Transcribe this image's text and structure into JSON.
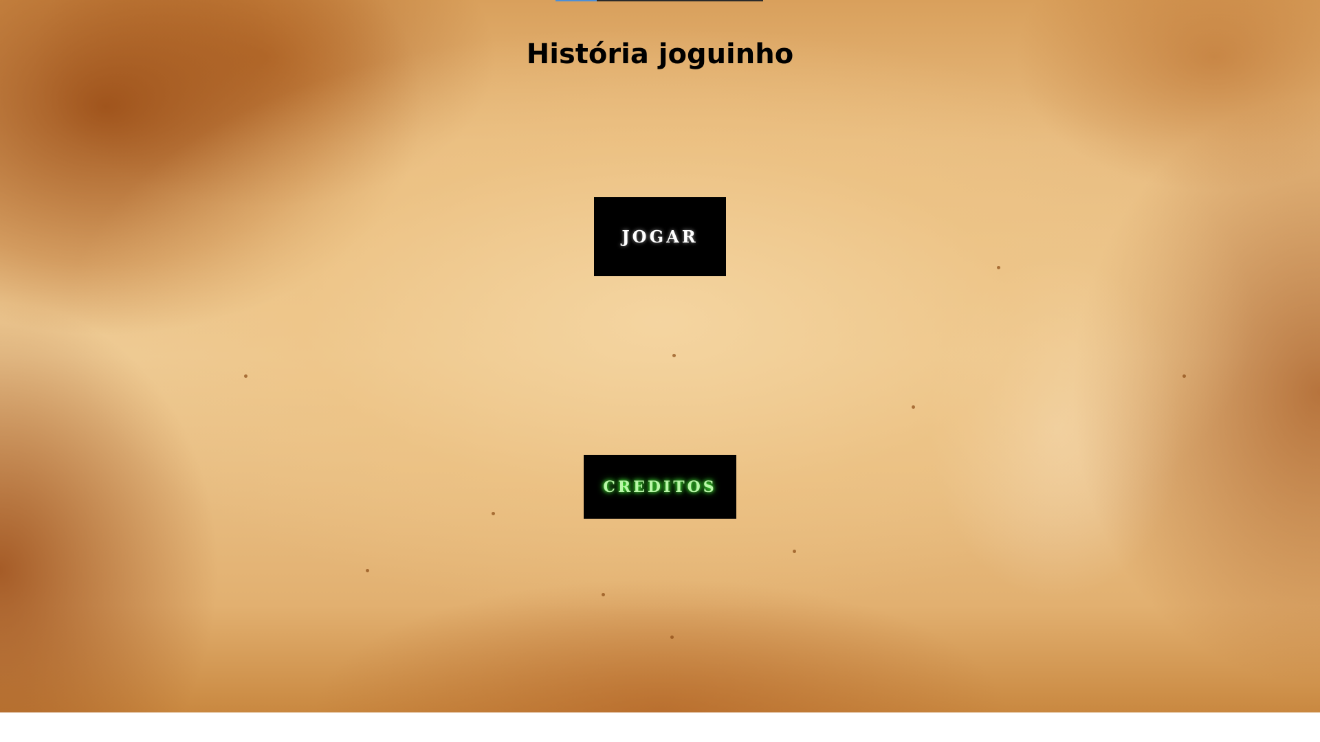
{
  "page": {
    "title": "História joguinho"
  },
  "menu": {
    "play_label": "JOGAR",
    "credits_label": "CREDITOS"
  },
  "colors": {
    "button_background": "#000000",
    "play_text": "#ffffff",
    "credits_text": "#b9f7a8",
    "credits_glow": "#4cff3a",
    "background_tone": "#e8bc80"
  }
}
